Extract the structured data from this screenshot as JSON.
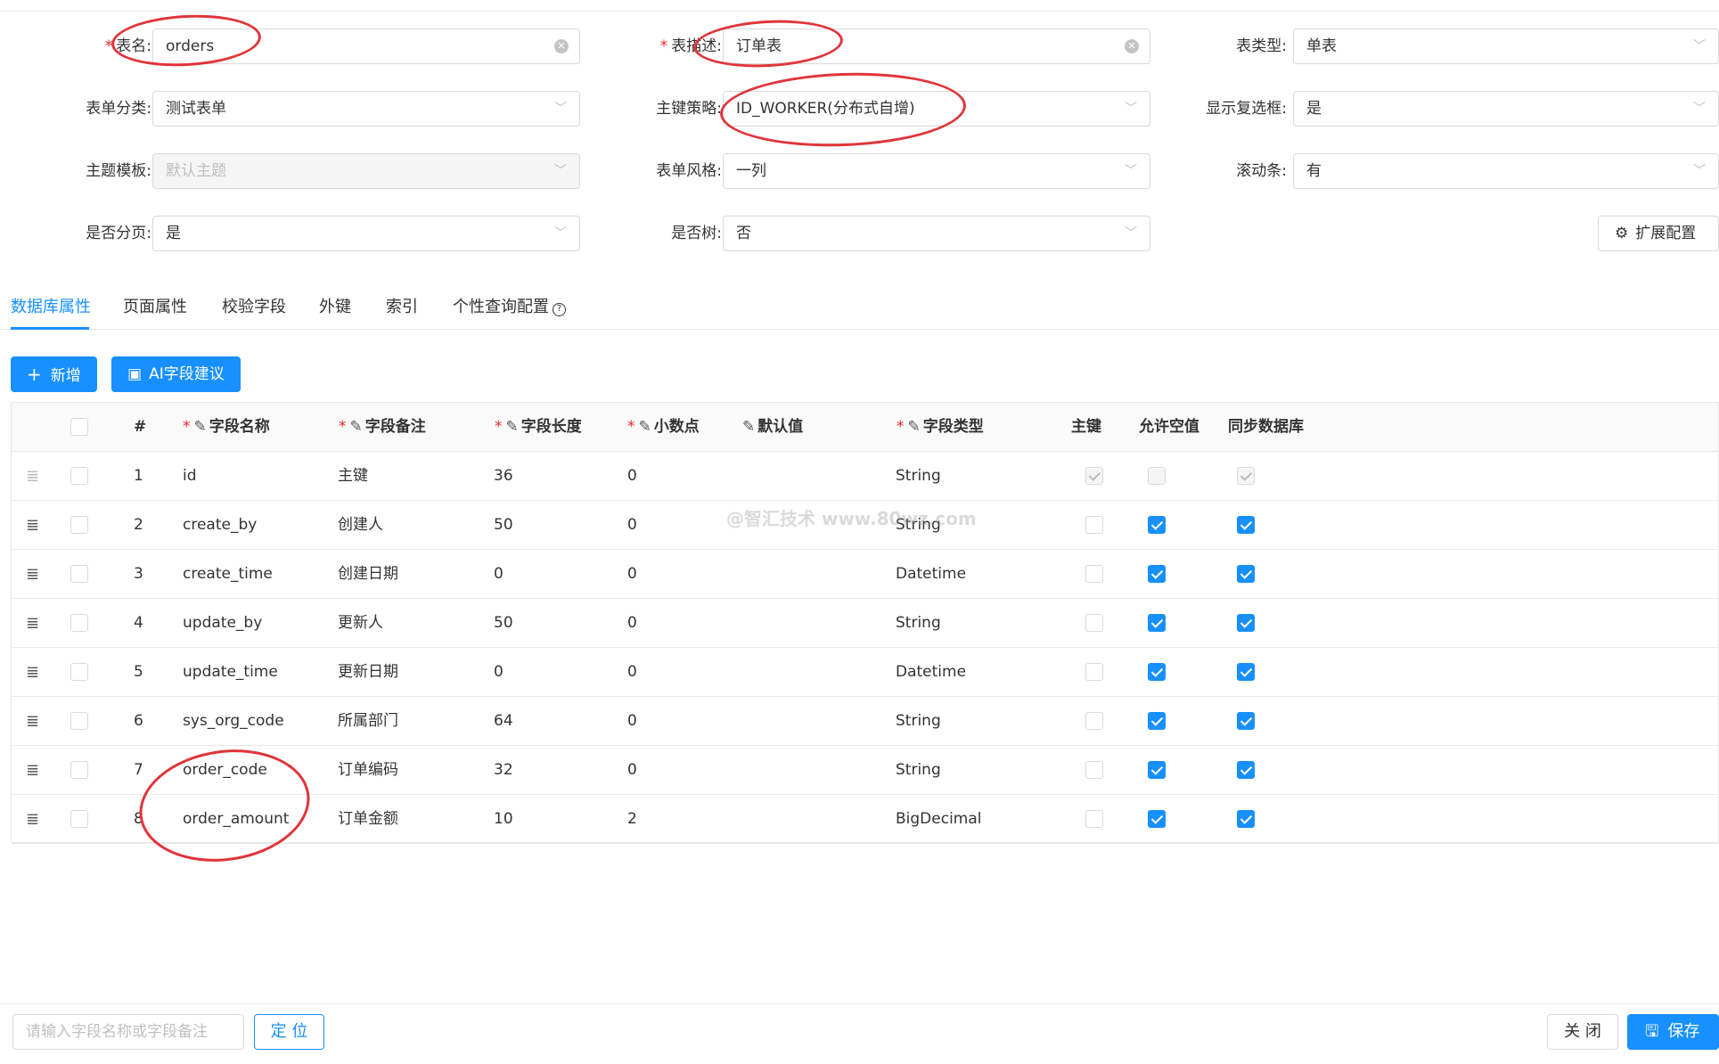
{
  "form": {
    "table_name": {
      "label": "表名:",
      "value": "orders"
    },
    "table_desc": {
      "label": "表描述:",
      "value": "订单表"
    },
    "table_type": {
      "label": "表类型:",
      "value": "单表"
    },
    "form_category": {
      "label": "表单分类:",
      "value": "测试表单"
    },
    "pk_strategy": {
      "label": "主键策略:",
      "value": "ID_WORKER(分布式自增)"
    },
    "show_checkbox": {
      "label": "显示复选框:",
      "value": "是"
    },
    "theme_template": {
      "label": "主题模板:",
      "value": "默认主题"
    },
    "form_style": {
      "label": "表单风格:",
      "value": "一列"
    },
    "scrollbar": {
      "label": "滚动条:",
      "value": "有"
    },
    "paging": {
      "label": "是否分页:",
      "value": "是"
    },
    "is_tree": {
      "label": "是否树:",
      "value": "否"
    },
    "ext_config_label": "扩展配置"
  },
  "tabs": [
    "数据库属性",
    "页面属性",
    "校验字段",
    "外键",
    "索引",
    "个性查询配置"
  ],
  "toolbar": {
    "add_label": "新增",
    "ai_label": "AI字段建议"
  },
  "table": {
    "headers": {
      "index": "#",
      "field_name": "字段名称",
      "field_comment": "字段备注",
      "field_length": "字段长度",
      "decimal": "小数点",
      "default_value": "默认值",
      "field_type": "字段类型",
      "primary_key": "主键",
      "nullable": "允许空值",
      "sync_db": "同步数据库"
    },
    "rows": [
      {
        "index": "1",
        "name": "id",
        "comment": "主键",
        "length": "36",
        "decimal": "0",
        "default": "",
        "type": "String",
        "pk": true,
        "nullable": false,
        "sync": true
      },
      {
        "index": "2",
        "name": "create_by",
        "comment": "创建人",
        "length": "50",
        "decimal": "0",
        "default": "",
        "type": "String",
        "pk": false,
        "nullable": true,
        "sync": true
      },
      {
        "index": "3",
        "name": "create_time",
        "comment": "创建日期",
        "length": "0",
        "decimal": "0",
        "default": "",
        "type": "Datetime",
        "pk": false,
        "nullable": true,
        "sync": true
      },
      {
        "index": "4",
        "name": "update_by",
        "comment": "更新人",
        "length": "50",
        "decimal": "0",
        "default": "",
        "type": "String",
        "pk": false,
        "nullable": true,
        "sync": true
      },
      {
        "index": "5",
        "name": "update_time",
        "comment": "更新日期",
        "length": "0",
        "decimal": "0",
        "default": "",
        "type": "Datetime",
        "pk": false,
        "nullable": true,
        "sync": true
      },
      {
        "index": "6",
        "name": "sys_org_code",
        "comment": "所属部门",
        "length": "64",
        "decimal": "0",
        "default": "",
        "type": "String",
        "pk": false,
        "nullable": true,
        "sync": true
      },
      {
        "index": "7",
        "name": "order_code",
        "comment": "订单编码",
        "length": "32",
        "decimal": "0",
        "default": "",
        "type": "String",
        "pk": false,
        "nullable": true,
        "sync": true
      },
      {
        "index": "8",
        "name": "order_amount",
        "comment": "订单金额",
        "length": "10",
        "decimal": "2",
        "default": "",
        "type": "BigDecimal",
        "pk": false,
        "nullable": true,
        "sync": true
      }
    ]
  },
  "watermark": "@智汇技术 www.80wz.com",
  "footer": {
    "search_placeholder": "请输入字段名称或字段备注",
    "locate_label": "定 位",
    "close_label": "关 闭",
    "save_label": "保存"
  },
  "colors": {
    "primary": "#1890ff",
    "required": "#f5222d",
    "annotation": "#e0343a"
  }
}
